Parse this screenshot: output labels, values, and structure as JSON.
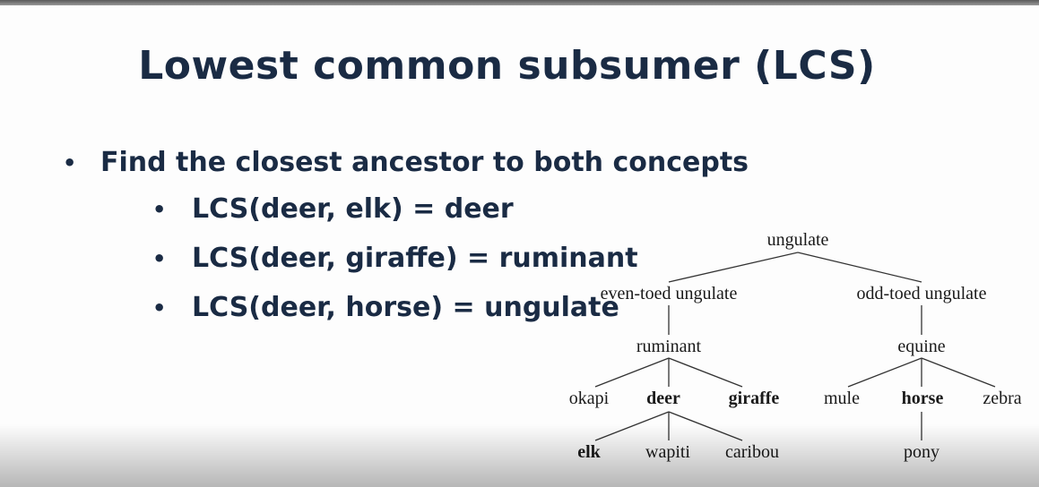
{
  "slide": {
    "title": "Lowest common subsumer (LCS)",
    "bullet": "Find the closest ancestor to both concepts",
    "sub_bullets": [
      "LCS(deer, elk)  = deer",
      "LCS(deer, giraffe) = ruminant",
      "LCS(deer, horse) = ungulate"
    ]
  },
  "tree": {
    "root": "ungulate",
    "left_branch": "even-toed ungulate",
    "right_branch": "odd-toed ungulate",
    "ruminant": "ruminant",
    "equine": "equine",
    "okapi": "okapi",
    "deer": "deer",
    "giraffe": "giraffe",
    "mule": "mule",
    "horse": "horse",
    "zebra": "zebra",
    "elk": "elk",
    "wapiti": "wapiti",
    "caribou": "caribou",
    "pony": "pony"
  }
}
